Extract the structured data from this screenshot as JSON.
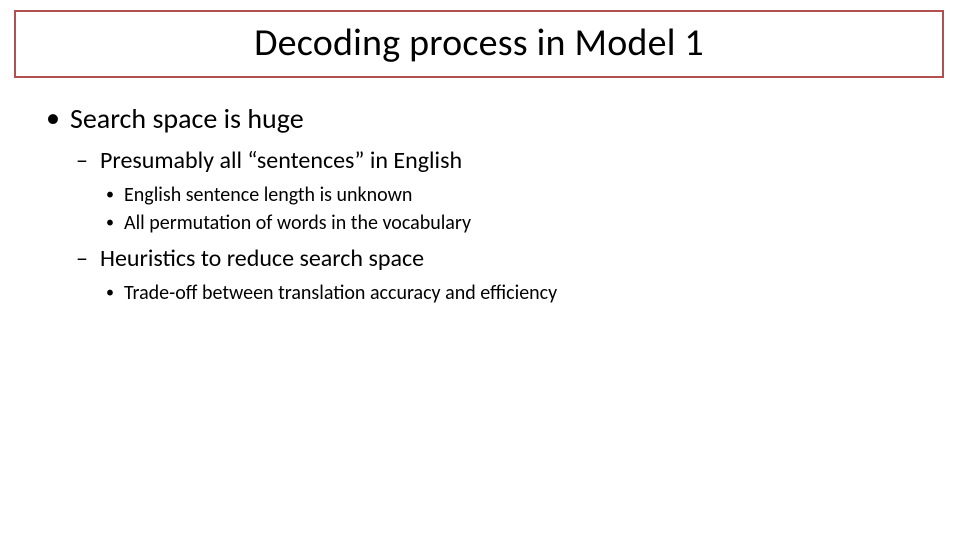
{
  "title": "Decoding process in Model 1",
  "bullets": {
    "l1_0": "Search space is huge",
    "l2_0": "Presumably all “sentences” in English",
    "l3_0": "English sentence length is unknown",
    "l3_1": "All permutation of words in the vocabulary",
    "l2_1": "Heuristics to reduce search space",
    "l3_2": "Trade-off between translation accuracy and efficiency"
  }
}
